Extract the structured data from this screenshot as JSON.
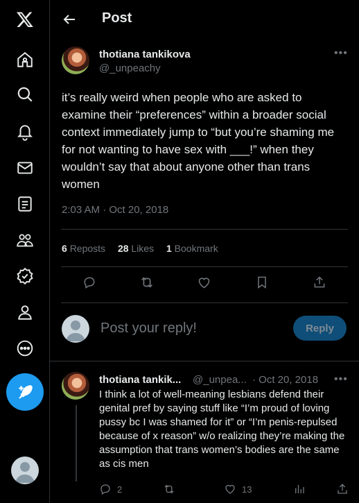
{
  "header": {
    "title": "Post"
  },
  "post": {
    "author_name": "thotiana tankikova",
    "author_handle": "@_unpeachy",
    "text": "it’s really weird when people who are asked to examine their “preferences” within a broader social context immediately jump to “but you’re shaming me for not wanting to have sex with ___!” when they wouldn’t say that about anyone other than trans women",
    "timestamp": "2:03 AM · Oct 20, 2018",
    "reposts_count": "6",
    "reposts_label": "Reposts",
    "likes_count": "28",
    "likes_label": "Likes",
    "bookmarks_count": "1",
    "bookmarks_label": "Bookmark"
  },
  "reply_box": {
    "placeholder": "Post your reply!",
    "button_label": "Reply"
  },
  "reply": {
    "author_name": "thotiana tankik...",
    "author_handle": "@_unpea...",
    "date": "· Oct 20, 2018",
    "text": "I think a lot of well-meaning lesbians defend their genital pref by saying stuff like “I’m proud of loving pussy bc I was shamed for it” or “I’m penis-repulsed because of x reason” w/o realizing they’re making the assumption that trans women’s bodies are the same as cis men",
    "replies_count": "2",
    "likes_count": "13"
  },
  "colors": {
    "accent": "#1d9bf0",
    "background": "#000000",
    "muted": "#71767b"
  },
  "icons": {
    "sidebar": [
      "x-logo-icon",
      "home-icon",
      "search-icon",
      "notifications-icon",
      "messages-icon",
      "lists-icon",
      "communities-icon",
      "verified-icon",
      "profile-icon",
      "more-icon",
      "compose-icon"
    ]
  }
}
